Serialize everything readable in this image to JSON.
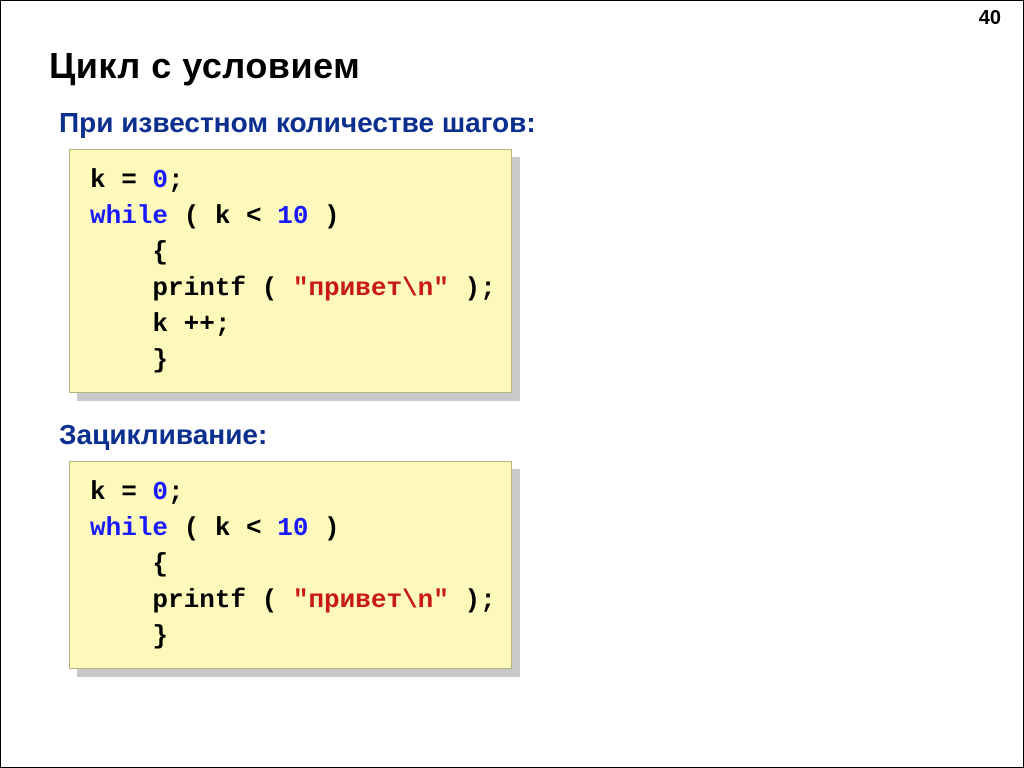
{
  "page_number": "40",
  "title": "Цикл с условием",
  "subtitle1": "При известном количестве шагов:",
  "subtitle2": "Зацикливание:",
  "code1": {
    "l1a": "k = ",
    "l1b": "0",
    "l1c": ";",
    "l2a": "while",
    "l2b": " ( k < ",
    "l2c": "10",
    "l2d": " )",
    "l3": "    {",
    "l4a": "    printf ( ",
    "l4b": "\"привет\\n\"",
    "l4c": " );",
    "l5": "    k ++;",
    "l6": "    }"
  },
  "code2": {
    "l1a": "k = ",
    "l1b": "0",
    "l1c": ";",
    "l2a": "while",
    "l2b": " ( k < ",
    "l2c": "10",
    "l2d": " )",
    "l3": "    {",
    "l4a": "    printf ( ",
    "l4b": "\"привет\\n\"",
    "l4c": " );",
    "l5": "    }"
  }
}
